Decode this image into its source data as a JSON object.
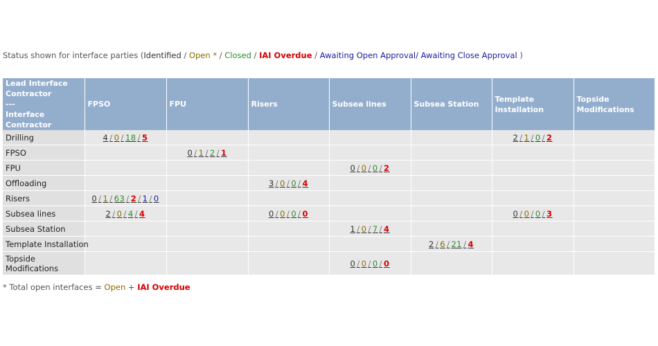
{
  "legend": {
    "prefix": "Status shown for interface parties (",
    "identified": "Identified",
    "s1": " / ",
    "open": "Open *",
    "s2": " / ",
    "closed": "Closed",
    "s3": " / ",
    "overdue": "IAI Overdue",
    "s4": " / ",
    "awaiting_open": "Awaiting Open Approval",
    "s5": "/ ",
    "awaiting_close": "Awaiting Close Approval",
    "suffix": " )"
  },
  "table": {
    "corner": {
      "line1": "Lead Interface Contractor",
      "line2": "---",
      "line3": "Interface Contractor"
    },
    "columns": [
      "FPSO",
      "FPU",
      "Risers",
      "Subsea lines",
      "Subsea Station",
      "Template Installation",
      "Topside Modifications"
    ],
    "rows": [
      {
        "name": "Drilling",
        "cells": [
          [
            4,
            0,
            18,
            5
          ],
          null,
          null,
          null,
          null,
          [
            2,
            1,
            0,
            2
          ],
          null
        ]
      },
      {
        "name": "FPSO",
        "cells": [
          null,
          [
            0,
            1,
            2,
            1
          ],
          null,
          null,
          null,
          null,
          null
        ]
      },
      {
        "name": "FPU",
        "cells": [
          null,
          null,
          null,
          [
            0,
            0,
            0,
            2
          ],
          null,
          null,
          null
        ]
      },
      {
        "name": "Offloading",
        "cells": [
          null,
          null,
          [
            3,
            0,
            0,
            4
          ],
          null,
          null,
          null,
          null
        ]
      },
      {
        "name": "Risers",
        "cells": [
          [
            0,
            1,
            63,
            2,
            1,
            0
          ],
          null,
          null,
          null,
          null,
          null,
          null
        ]
      },
      {
        "name": "Subsea lines",
        "cells": [
          [
            2,
            0,
            4,
            4
          ],
          null,
          [
            0,
            0,
            0,
            0
          ],
          null,
          null,
          [
            0,
            0,
            0,
            3
          ],
          null
        ]
      },
      {
        "name": "Subsea Station",
        "cells": [
          null,
          null,
          null,
          [
            1,
            0,
            7,
            4
          ],
          null,
          null,
          null
        ]
      },
      {
        "name": "Template Installation",
        "cells": [
          null,
          null,
          null,
          null,
          [
            2,
            6,
            21,
            4
          ],
          null,
          null
        ]
      },
      {
        "name": "Topside Modifications",
        "cells": [
          null,
          null,
          null,
          [
            0,
            0,
            0,
            0
          ],
          null,
          null,
          null
        ]
      }
    ]
  },
  "footnote": {
    "prefix": "* Total open interfaces = ",
    "open": "Open",
    "plus": " + ",
    "overdue": "IAI Overdue"
  },
  "colors": {
    "header_bg": "#93aecd",
    "cell_bg": "#e8e8e8",
    "identified": "#333333",
    "open": "#8b6b00",
    "closed": "#2e8b2e",
    "overdue": "#d40000",
    "approval": "#1a1aa0"
  }
}
